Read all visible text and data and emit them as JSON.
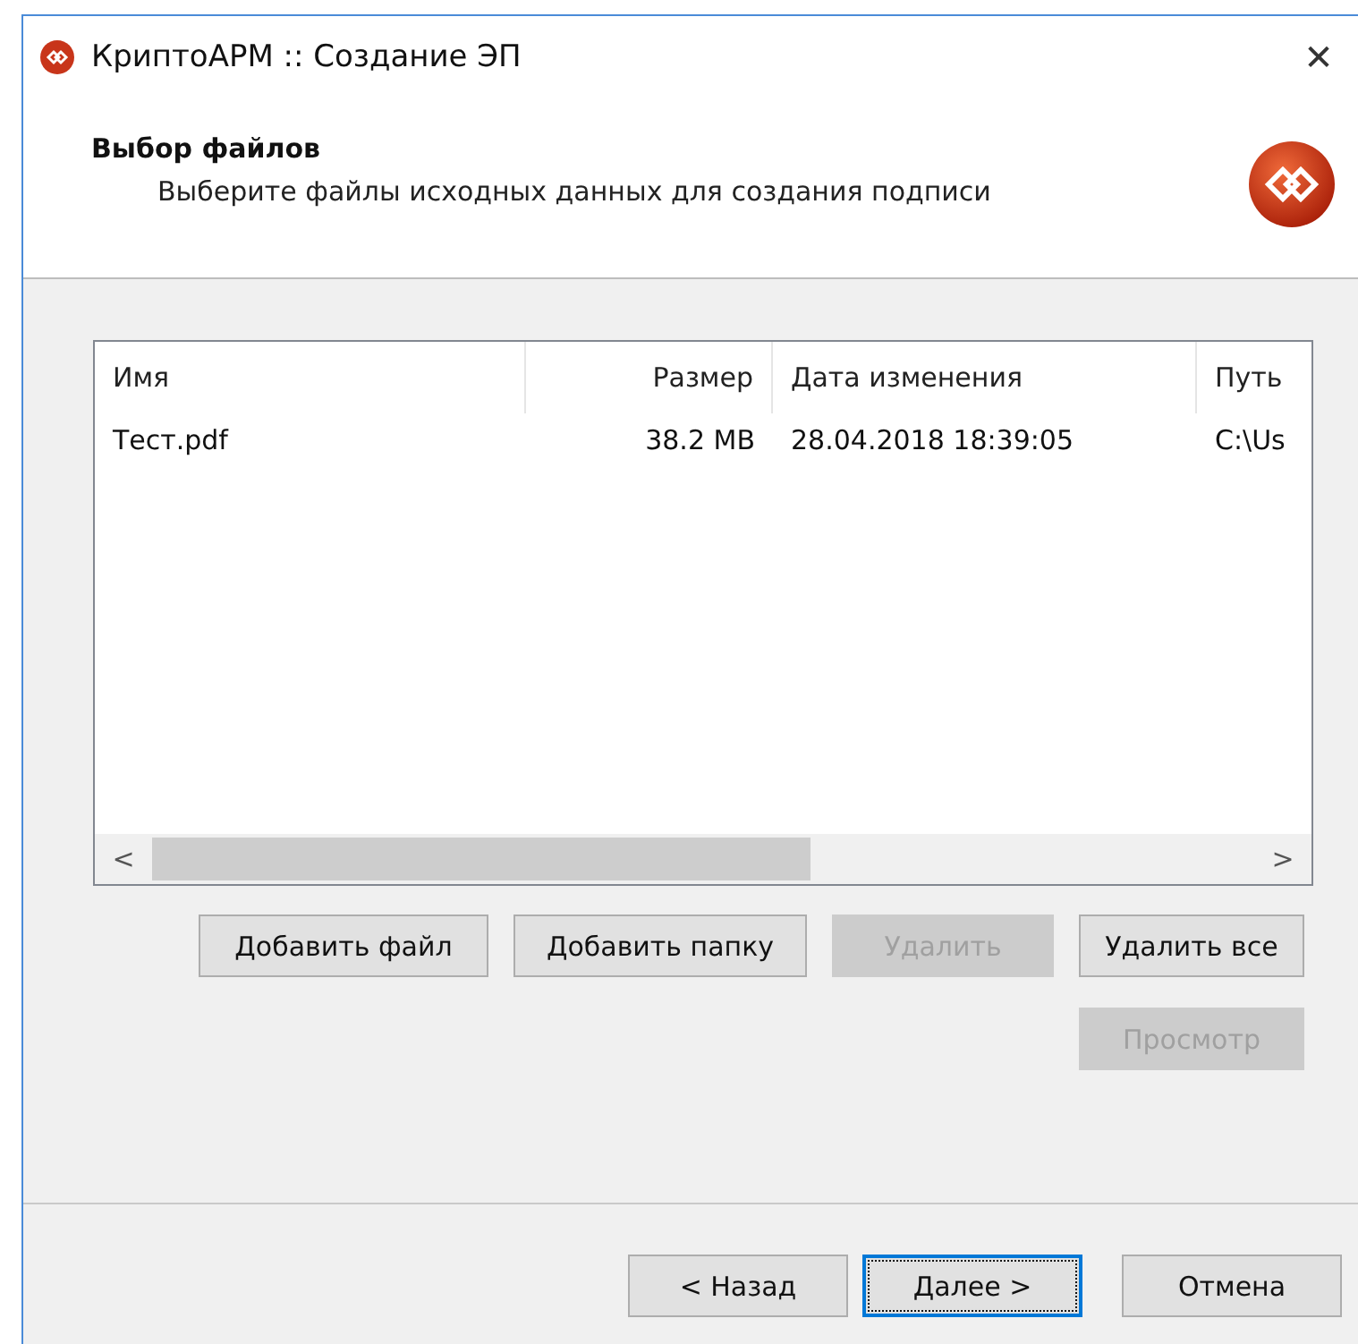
{
  "window": {
    "title": "КриптоАРМ :: Создание ЭП",
    "close": "✕"
  },
  "header": {
    "title": "Выбор файлов",
    "subtitle": "Выберите файлы исходных данных для создания подписи"
  },
  "table": {
    "columns": [
      "Имя",
      "Размер",
      "Дата изменения",
      "Путь"
    ],
    "rows": [
      {
        "cells": [
          "Тест.pdf",
          "38.2 MB",
          "28.04.2018 18:39:05",
          "C:\\Us"
        ],
        "selected": false
      }
    ],
    "scroll_left": "<",
    "scroll_right": ">"
  },
  "actions": [
    {
      "label": "Добавить файл",
      "disabled": false
    },
    {
      "label": "Добавить папку",
      "disabled": false
    },
    {
      "label": "Удалить",
      "disabled": true
    },
    {
      "label": "Удалить все",
      "disabled": false
    },
    {
      "label": "Просмотр",
      "disabled": true
    }
  ],
  "footer": [
    {
      "label": "< Назад",
      "default": false
    },
    {
      "label": "Далее >",
      "default": true
    },
    {
      "label": "Отмена",
      "default": false
    }
  ]
}
